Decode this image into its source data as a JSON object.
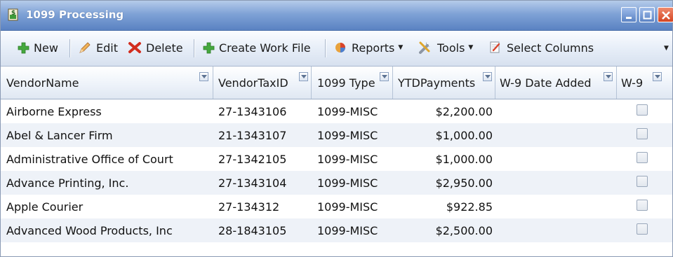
{
  "window": {
    "title": "1099 Processing",
    "icon": "dollar-document-icon"
  },
  "toolbar": {
    "new_label": "New",
    "edit_label": "Edit",
    "delete_label": "Delete",
    "create_work_file_label": "Create Work File",
    "reports_label": "Reports",
    "tools_label": "Tools",
    "select_columns_label": "Select Columns"
  },
  "grid": {
    "columns": [
      {
        "key": "vendor_name",
        "label": "VendorName"
      },
      {
        "key": "vendor_tax_id",
        "label": "VendorTaxID"
      },
      {
        "key": "type_1099",
        "label": "1099 Type"
      },
      {
        "key": "ytd_payments",
        "label": "YTDPayments"
      },
      {
        "key": "w9_date_added",
        "label": "W-9 Date Added"
      },
      {
        "key": "w9",
        "label": "W-9"
      }
    ],
    "rows": [
      {
        "vendor_name": "Airborne Express",
        "vendor_tax_id": "27-1343106",
        "type_1099": "1099-MISC",
        "ytd_payments": "$2,200.00",
        "w9_date_added": "",
        "w9": false
      },
      {
        "vendor_name": "Abel & Lancer Firm",
        "vendor_tax_id": "21-1343107",
        "type_1099": "1099-MISC",
        "ytd_payments": "$1,000.00",
        "w9_date_added": "",
        "w9": false
      },
      {
        "vendor_name": "Administrative Office of Court",
        "vendor_tax_id": "27-1342105",
        "type_1099": "1099-MISC",
        "ytd_payments": "$1,000.00",
        "w9_date_added": "",
        "w9": false
      },
      {
        "vendor_name": "Advance Printing, Inc.",
        "vendor_tax_id": "27-1343104",
        "type_1099": "1099-MISC",
        "ytd_payments": "$2,950.00",
        "w9_date_added": "",
        "w9": false
      },
      {
        "vendor_name": "Apple Courier",
        "vendor_tax_id": "27-134312",
        "type_1099": "1099-MISC",
        "ytd_payments": "$922.85",
        "w9_date_added": "",
        "w9": false
      },
      {
        "vendor_name": "Advanced Wood Products, Inc",
        "vendor_tax_id": "28-1843105",
        "type_1099": "1099-MISC",
        "ytd_payments": "$2,500.00",
        "w9_date_added": "",
        "w9": false
      }
    ]
  },
  "colors": {
    "titlebar": "#5a82c2",
    "alt_row": "#eef2f8",
    "close_button": "#d44522"
  }
}
